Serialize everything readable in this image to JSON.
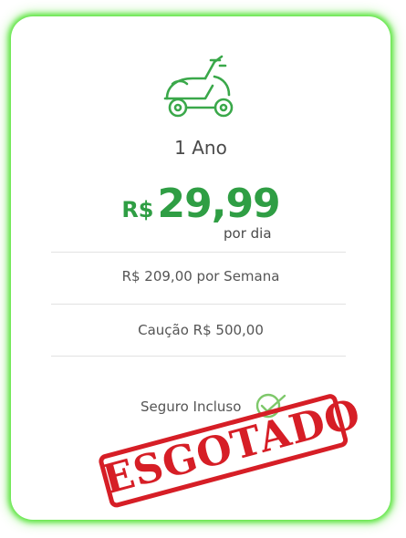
{
  "plan": {
    "icon": "scooter-icon",
    "title": "1 Ano",
    "currency": "R$",
    "price": "29,99",
    "period": "por dia",
    "weekly": "R$ 209,00 por Semana",
    "deposit": "Caução R$ 500,00",
    "insurance": "Seguro Incluso",
    "insurance_icon": "check-icon"
  },
  "stamp": {
    "text": "ESGOTADO",
    "color": "#d61e26"
  },
  "colors": {
    "accent": "#2f9e44",
    "glow": "#46e128"
  }
}
